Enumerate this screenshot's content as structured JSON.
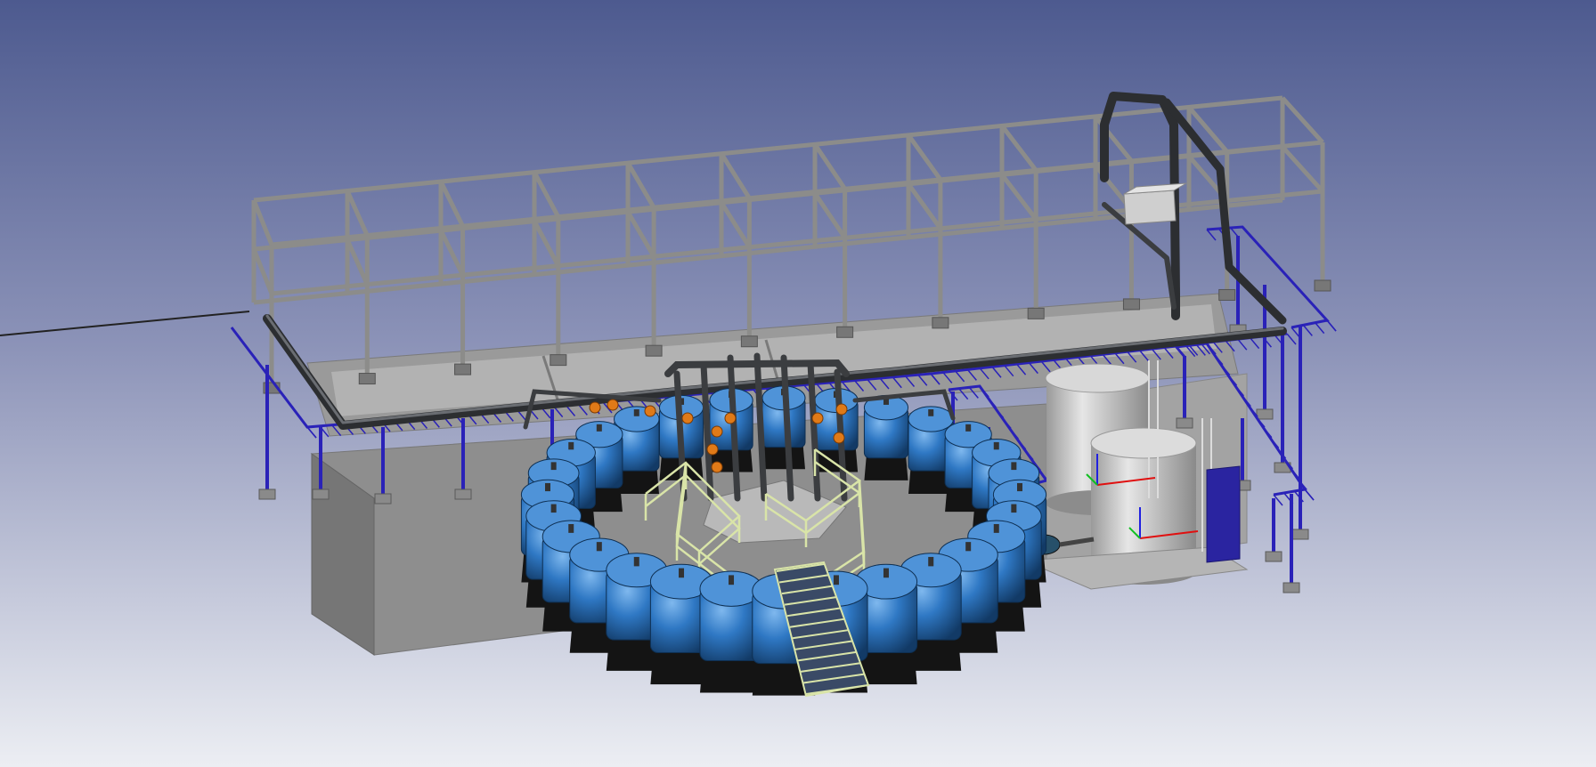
{
  "viewport": {
    "background_top": "#4d5a8f",
    "background_bottom": "#eceef3"
  },
  "colors": {
    "structure_steel": "#8c8c8a",
    "structure_steel_light": "#a7a7a4",
    "platform_blue": "#2a22b8",
    "basin_concrete_light": "#a3a3a3",
    "basin_concrete_mid": "#8e8e8e",
    "basin_concrete_dark": "#707070",
    "pipe_dark": "#3b3d40",
    "vessel_blue": "#2f78c4",
    "vessel_base": "#141414",
    "handrail_yellow": "#d9e4a8",
    "valve_orange": "#e07a18",
    "tank_silver": "#c9c9c9",
    "axis_x": "#e01010",
    "axis_y": "#10c020",
    "axis_z": "#2020e0"
  },
  "scene": {
    "icons": {
      "filter_vessel": "filter-vessel-icon",
      "storage_tank": "storage-tank-icon",
      "pump": "pump-icon",
      "valve": "valve-icon",
      "axis_triad": "axis-triad-icon"
    }
  }
}
